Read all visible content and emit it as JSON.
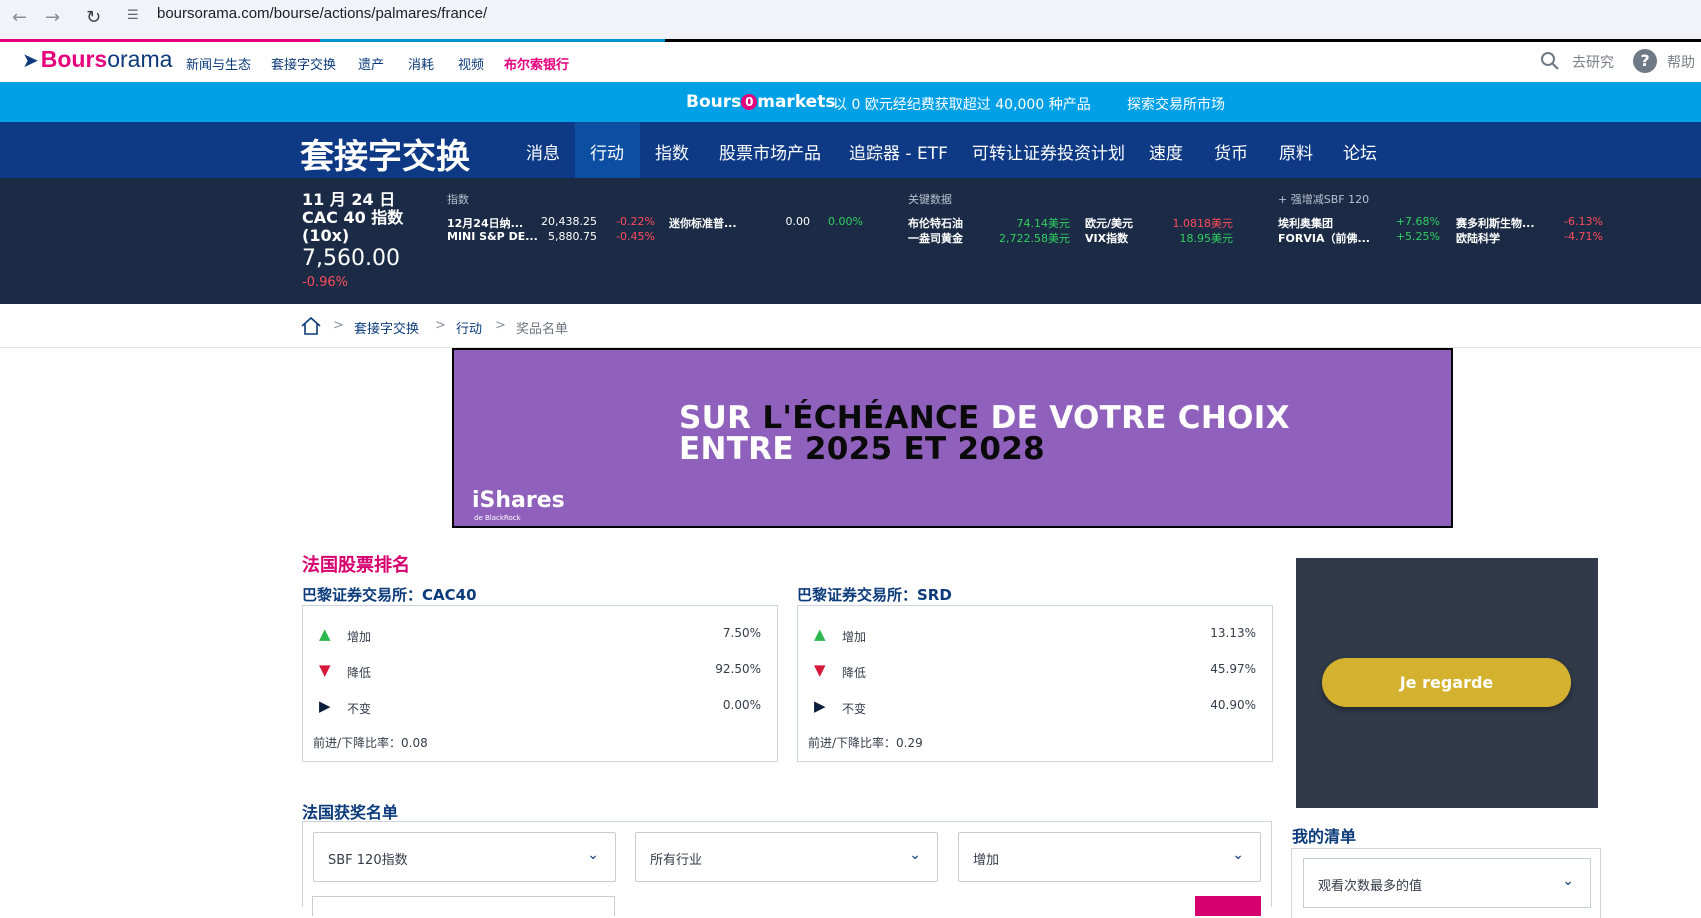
{
  "browser": {
    "url": "boursorama.com/bourse/actions/palmares/france/"
  },
  "topnav": {
    "logo_b": "Bours",
    "logo_rest": "orama",
    "items": [
      "新闻与生态",
      "套接字交换",
      "遗产",
      "消耗",
      "视频",
      "布尔索银行"
    ],
    "search_label": "去研究",
    "help_label": "帮助"
  },
  "promo": {
    "brand_a": "Bours",
    "brand_zero": "0",
    "brand_b": "markets",
    "text": "以 0 欧元经纪费获取超过 40,000 种产品",
    "link": "探索交易所市场"
  },
  "mainnav": {
    "title": "套接字交换",
    "items": [
      "消息",
      "行动",
      "指数",
      "股票市场产品",
      "追踪器 - ETF",
      "可转让证券投资计划",
      "速度",
      "货币",
      "原料",
      "论坛"
    ],
    "active": "行动"
  },
  "ticker": {
    "date": "11 月 24 日",
    "index_name": "CAC 40 指数",
    "leverage": "(10x)",
    "price": "7,560.00",
    "change": "-0.96%",
    "indices_head": "指数",
    "indices": [
      {
        "name": "12月24日纳...",
        "value": "20,438.25",
        "change": "-0.22%"
      },
      {
        "name": "MINI S&P DE...",
        "value": "5,880.75",
        "change": "-0.45%"
      },
      {
        "name": "迷你标准普...",
        "value": "0.00",
        "change": "0.00%"
      }
    ],
    "key_head": "关键数据",
    "key": [
      {
        "name": "布伦特石油",
        "value": "74.14美元"
      },
      {
        "name": "一盎司黄金",
        "value": "2,722.58美元"
      },
      {
        "name": "欧元/美元",
        "value": "1.0818美元"
      },
      {
        "name": "VIX指数",
        "value": "18.95美元"
      }
    ],
    "movers_head": "+ 强增减SBF 120",
    "movers": [
      {
        "name": "埃利奥集团",
        "change": "+7.68%"
      },
      {
        "name": "FORVIA（前佛...",
        "change": "+5.25%"
      },
      {
        "name": "赛多利斯生物...",
        "change": "-6.13%"
      },
      {
        "name": "欧陆科学",
        "change": "-4.71%"
      }
    ]
  },
  "breadcrumb": [
    "套接字交换",
    "行动",
    "奖品名单"
  ],
  "ad": {
    "w1": "SUR ",
    "w2": "L'ÉCHÉANCE ",
    "w3": "DE VOTRE CHOIX",
    "w4": "ENTRE ",
    "w5": "2025 ET 2028",
    "brand": "iShares",
    "brand_sub": "de BlackRock"
  },
  "ranking": {
    "title": "法国股票排名",
    "cac40": {
      "title": "巴黎证券交易所：CAC40",
      "rows": [
        {
          "label": "增加",
          "value": "7.50%"
        },
        {
          "label": "降低",
          "value": "92.50%"
        },
        {
          "label": "不变",
          "value": "0.00%"
        }
      ],
      "ratio": "前进/下降比率：0.08"
    },
    "srd": {
      "title": "巴黎证券交易所：SRD",
      "rows": [
        {
          "label": "增加",
          "value": "13.13%"
        },
        {
          "label": "降低",
          "value": "45.97%"
        },
        {
          "label": "不变",
          "value": "40.90%"
        }
      ],
      "ratio": "前进/下降比率：0.29"
    }
  },
  "winners": {
    "title": "法国获奖名单",
    "filters": [
      "SBF 120指数",
      "所有行业",
      "增加"
    ]
  },
  "sidebox": {
    "button": "Je regarde"
  },
  "watchlist": {
    "title": "我的清单",
    "select": "观看次数最多的值"
  }
}
